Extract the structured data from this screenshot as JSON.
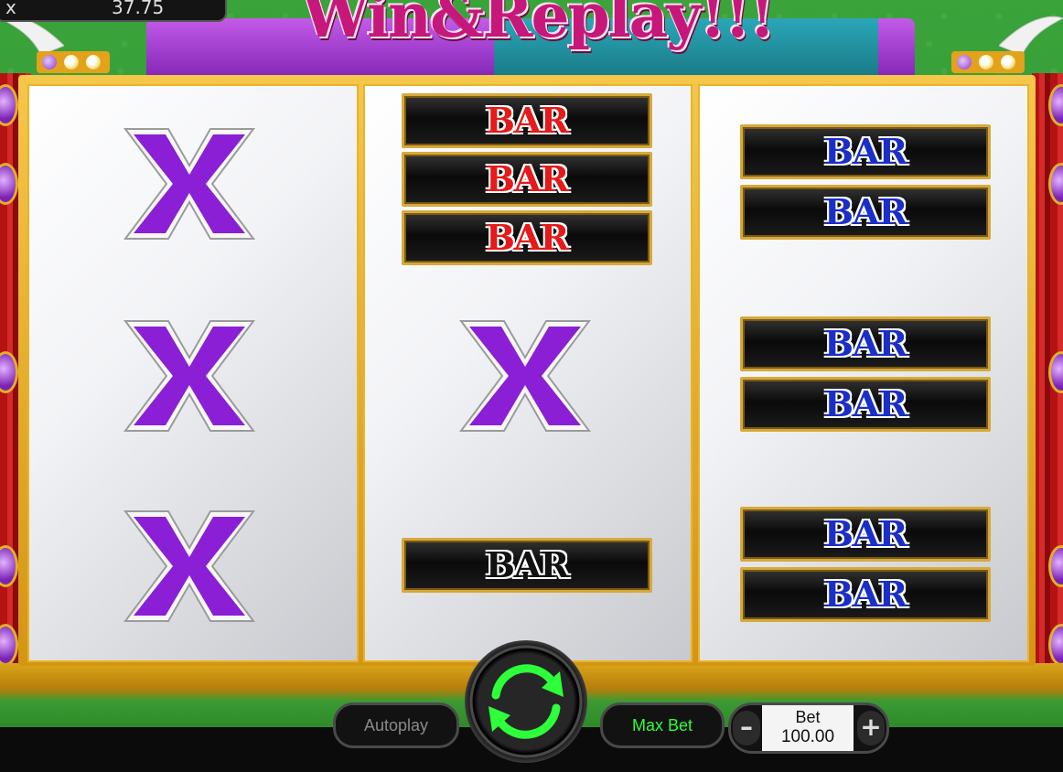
{
  "header": {
    "balance_label": "x",
    "balance_value": "37.75",
    "game_title": "Win&Replay!!!"
  },
  "reels": {
    "reel1": [
      "x-symbol",
      "x-symbol",
      "x-symbol"
    ],
    "reel2": [
      "red-bar-x3",
      "x-symbol",
      "black-bar-x1"
    ],
    "reel3": [
      "blue-bar-x2",
      "blue-bar-x2",
      "blue-bar-x2"
    ],
    "bar_text": "BAR"
  },
  "controls": {
    "autoplay_label": "Autoplay",
    "max_bet_label": "Max Bet",
    "bet_label": "Bet",
    "bet_value": "100.00",
    "minus_label": "–",
    "plus_label": "+"
  },
  "colors": {
    "x_symbol": "#8a1fd6",
    "red_bar": "#e51a1a",
    "blue_bar": "#1a2ec8",
    "spin_arrow": "#2dff3a",
    "frame_gold": "#e3a21a"
  }
}
